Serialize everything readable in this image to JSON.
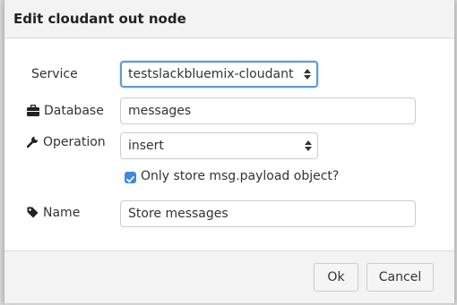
{
  "dialog": {
    "title": "Edit cloudant out node"
  },
  "form": {
    "service": {
      "label": "Service",
      "value": "testslackbluemix-cloudant"
    },
    "database": {
      "label": "Database",
      "icon": "briefcase-icon",
      "value": "messages"
    },
    "operation": {
      "label": "Operation",
      "icon": "wrench-icon",
      "value": "insert"
    },
    "only_payload": {
      "label": "Only store msg.payload object?",
      "checked": true
    },
    "name": {
      "label": "Name",
      "icon": "tag-icon",
      "value": "Store messages"
    }
  },
  "footer": {
    "ok_label": "Ok",
    "cancel_label": "Cancel"
  },
  "colors": {
    "checkbox": "#3f8ae0",
    "focus_border": "#5b9bd5"
  }
}
